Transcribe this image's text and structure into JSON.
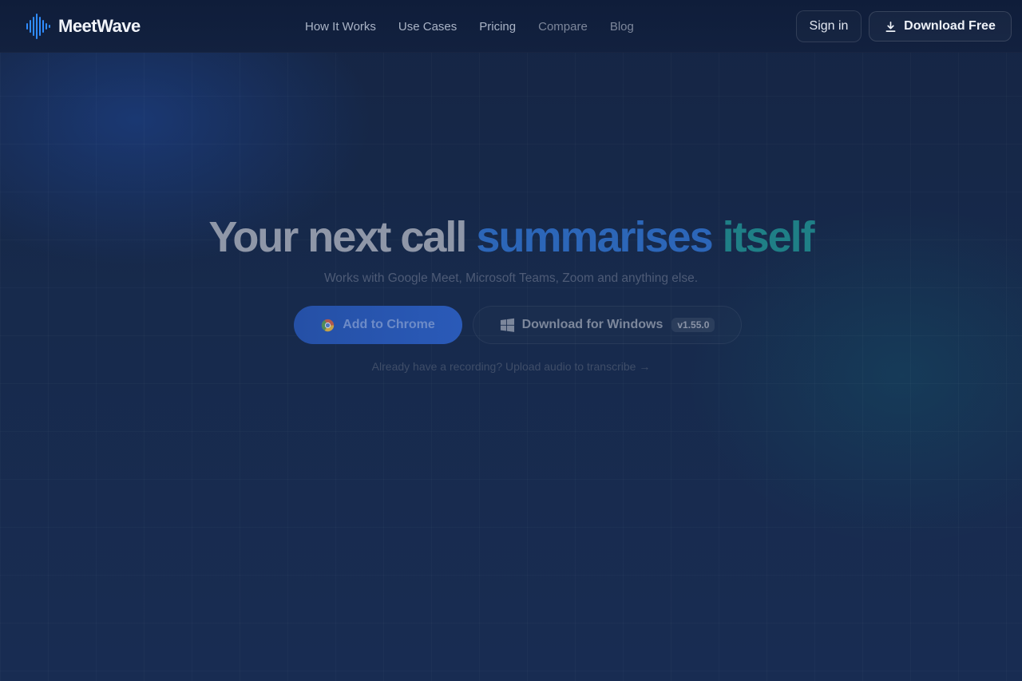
{
  "brand": {
    "name": "MeetWave",
    "accent": "#2f8cff"
  },
  "nav": {
    "items": [
      {
        "label": "How It Works"
      },
      {
        "label": "Use Cases"
      },
      {
        "label": "Pricing"
      },
      {
        "label": "Compare"
      },
      {
        "label": "Blog"
      }
    ]
  },
  "header": {
    "signin_label": "Sign in",
    "download_label": "Download Free",
    "download_icon": "download-icon"
  },
  "hero": {
    "title_plain": "Your next call ",
    "title_highlight_1": "summarises ",
    "title_highlight_2": "itself",
    "subtitle": "Works with Google Meet, Microsoft Teams, Zoom and anything else.",
    "chrome_button_label": "Add to Chrome",
    "chrome_icon": "chrome-icon",
    "windows_button_label": "Download for Windows",
    "windows_icon": "windows-icon",
    "windows_version": "v1.55.0",
    "upload_link": "Already have a recording? Upload audio to transcribe →"
  }
}
